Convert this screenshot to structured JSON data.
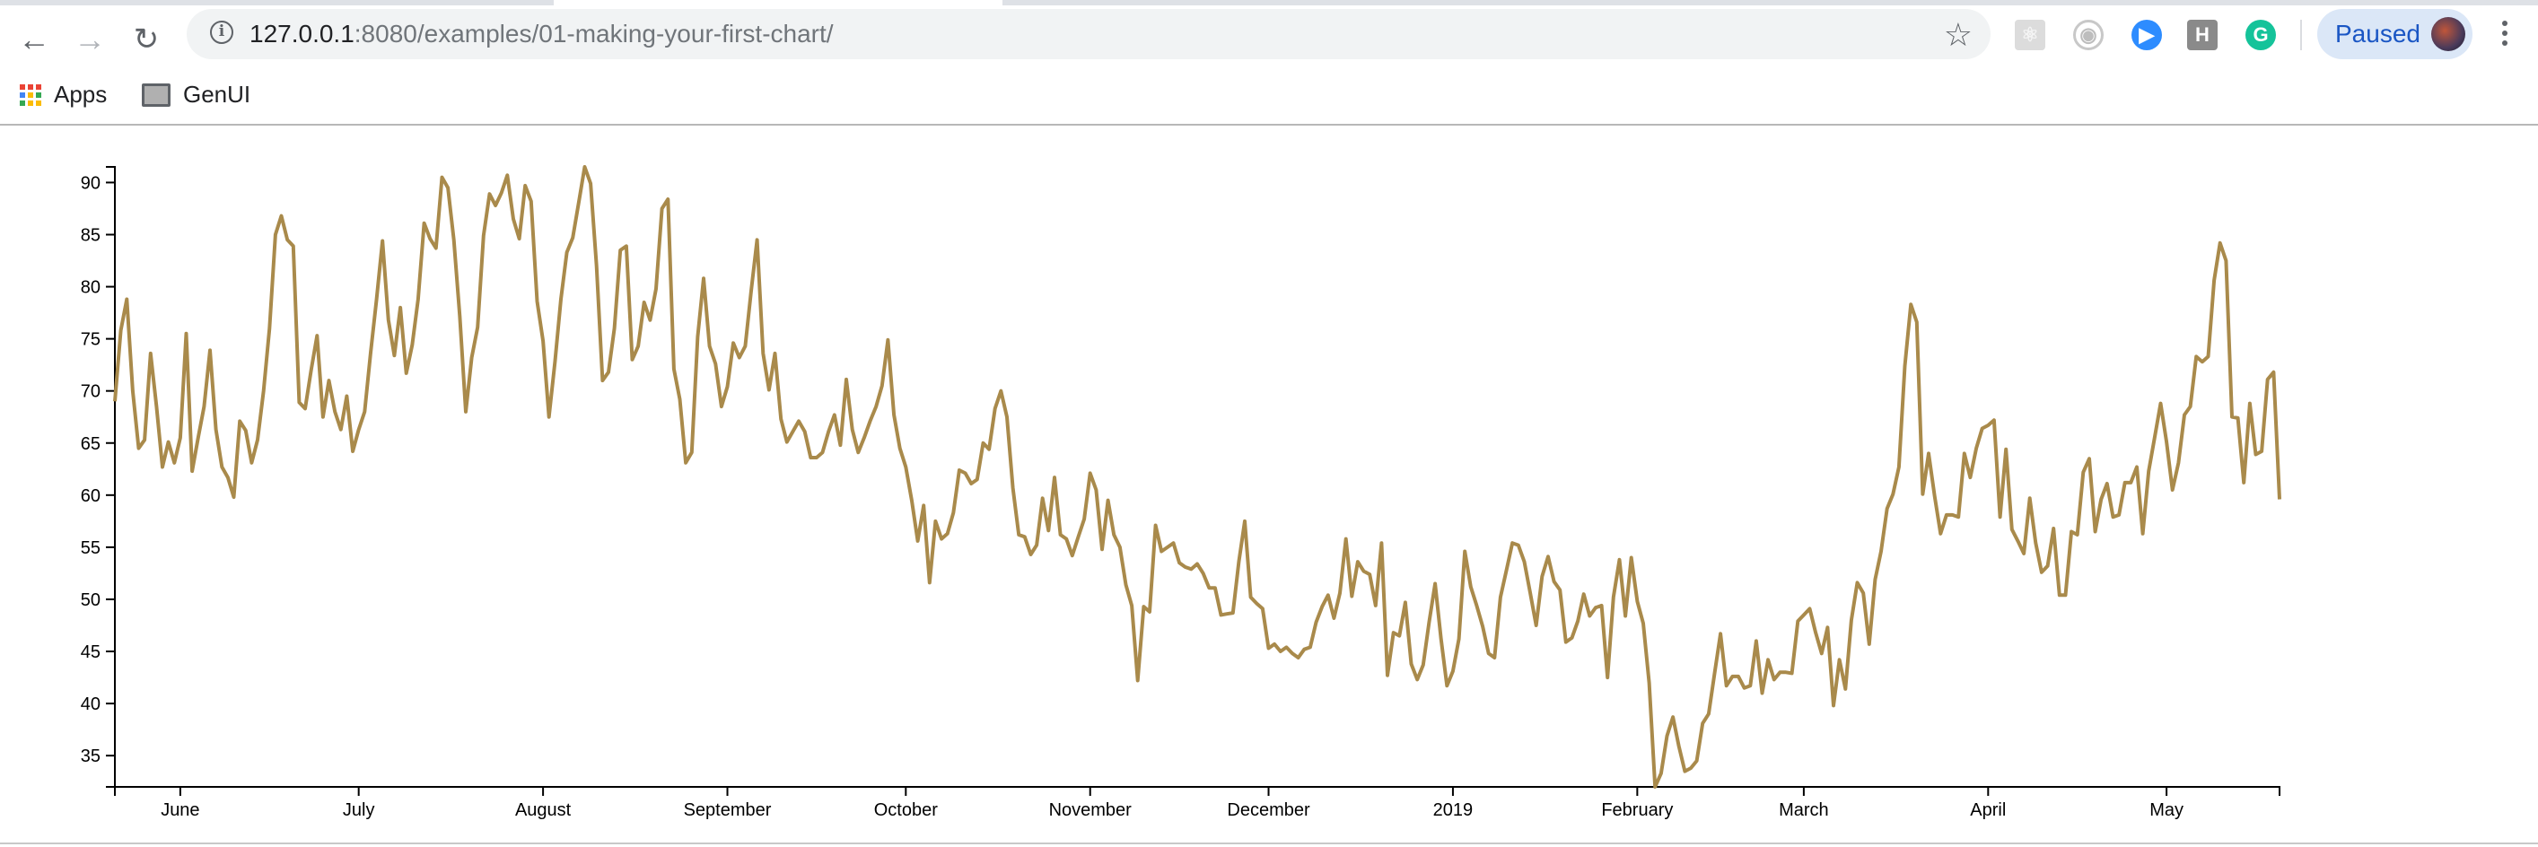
{
  "browser": {
    "url_host": "127.0.0.1",
    "url_rest": ":8080/examples/01-making-your-first-chart/",
    "profile_label": "Paused",
    "extensions": [
      {
        "icon": "react-devtools-icon",
        "glyph": "⚛",
        "color": "#dcdcdc"
      },
      {
        "icon": "record-icon",
        "glyph": "◉",
        "color": "#ffffff"
      },
      {
        "icon": "zoom-icon",
        "glyph": "▶",
        "color": "#2d8cff"
      },
      {
        "icon": "h-extension-icon",
        "glyph": "H",
        "color": "#8a8a8a"
      },
      {
        "icon": "grammarly-icon",
        "glyph": "G",
        "color": "#15c39a"
      }
    ],
    "bookmarks": [
      {
        "label": "Apps",
        "icon": "apps-grid-icon"
      },
      {
        "label": "GenUI",
        "icon": "folder-icon"
      }
    ]
  },
  "chart_data": {
    "type": "line",
    "title": "",
    "xlabel": "",
    "ylabel": "",
    "line_color": "#a98a4b",
    "grid": false,
    "ylim": [
      32.0,
      91.5
    ],
    "xlim": [
      "2018-05-21",
      "2019-05-20"
    ],
    "y_ticks": [
      "35",
      "40",
      "45",
      "50",
      "55",
      "60",
      "65",
      "70",
      "75",
      "80",
      "85",
      "90"
    ],
    "x_ticks": [
      {
        "date": "2018-06-01",
        "label": "June"
      },
      {
        "date": "2018-07-01",
        "label": "July"
      },
      {
        "date": "2018-08-01",
        "label": "August"
      },
      {
        "date": "2018-09-01",
        "label": "September"
      },
      {
        "date": "2018-10-01",
        "label": "October"
      },
      {
        "date": "2018-11-01",
        "label": "November"
      },
      {
        "date": "2018-12-01",
        "label": "December"
      },
      {
        "date": "2019-01-01",
        "label": "2019"
      },
      {
        "date": "2019-02-01",
        "label": "February"
      },
      {
        "date": "2019-03-01",
        "label": "March"
      },
      {
        "date": "2019-04-01",
        "label": "April"
      },
      {
        "date": "2019-05-01",
        "label": "May"
      }
    ],
    "series_by_month": [
      {
        "month": "2018-05",
        "first_day": 21,
        "values": [
          69.0,
          75.8,
          78.8,
          70.0,
          64.5,
          65.3,
          73.6,
          68.5,
          62.7,
          65.1,
          63.1
        ]
      },
      {
        "month": "2018-06",
        "first_day": 1,
        "values": [
          65.5,
          75.5,
          62.3,
          65.5,
          68.5,
          73.9,
          66.3,
          62.7,
          61.7,
          59.8,
          67.1,
          66.2,
          63.1,
          65.3,
          70.0,
          76.0,
          85.0,
          86.8,
          84.5,
          83.9,
          68.9,
          68.3,
          72.0,
          75.3,
          67.5,
          71.0,
          68.0,
          66.3,
          69.5,
          64.2
        ]
      },
      {
        "month": "2018-07",
        "first_day": 1,
        "values": [
          66.3,
          68.0,
          73.6,
          78.8,
          84.4,
          76.8,
          73.4,
          78.0,
          71.7,
          74.4,
          78.8,
          86.1,
          84.6,
          83.7,
          90.5,
          89.5,
          84.5,
          77.2,
          68.0,
          73.2,
          76.1,
          84.9,
          88.9,
          87.8,
          89.0,
          90.7,
          86.5,
          84.6,
          89.7,
          88.2,
          78.6
        ]
      },
      {
        "month": "2018-08",
        "first_day": 1,
        "values": [
          74.8,
          67.5,
          72.8,
          78.8,
          83.3,
          84.7,
          88.1,
          91.5,
          89.9,
          82.0,
          71.0,
          71.8,
          76.0,
          83.5,
          83.9,
          73.0,
          74.3,
          78.5,
          76.8,
          79.8,
          87.5,
          88.4,
          72.1,
          69.2,
          63.1,
          64.1,
          75.2,
          80.8,
          74.3,
          72.6,
          68.5
        ]
      },
      {
        "month": "2018-09",
        "first_day": 1,
        "values": [
          70.4,
          74.6,
          73.2,
          74.3,
          79.6,
          84.5,
          73.6,
          70.1,
          73.6,
          67.3,
          65.1,
          66.1,
          67.1,
          66.1,
          63.6,
          63.6,
          64.1,
          66.1,
          67.7,
          64.8,
          71.1,
          66.3,
          64.1,
          65.5,
          67.1,
          68.5,
          70.5,
          74.9,
          67.7,
          64.5
        ]
      },
      {
        "month": "2018-10",
        "first_day": 1,
        "values": [
          62.7,
          59.5,
          55.6,
          59.0,
          51.6,
          57.5,
          55.8,
          56.3,
          58.3,
          62.4,
          62.1,
          61.1,
          61.5,
          65.0,
          64.4,
          68.3,
          70.0,
          67.5,
          60.7,
          56.2,
          56.0,
          54.3,
          55.2,
          59.7,
          56.6,
          61.7,
          56.2,
          55.8,
          54.2,
          56.0,
          57.7
        ]
      },
      {
        "month": "2018-11",
        "first_day": 1,
        "values": [
          62.1,
          60.5,
          54.8,
          59.5,
          56.2,
          55.0,
          51.4,
          49.4,
          42.2,
          49.3,
          48.8,
          57.1,
          54.6,
          55.0,
          55.4,
          53.5,
          53.1,
          52.9,
          53.4,
          52.5,
          51.1,
          51.1,
          48.5,
          48.6,
          48.7,
          53.6,
          57.5,
          50.2,
          49.6,
          49.1
        ]
      },
      {
        "month": "2018-12",
        "first_day": 1,
        "values": [
          45.3,
          45.7,
          45.0,
          45.4,
          44.8,
          44.4,
          45.2,
          45.4,
          47.8,
          49.3,
          50.4,
          48.2,
          50.6,
          55.8,
          50.3,
          53.6,
          52.7,
          52.4,
          49.4,
          55.4,
          42.7,
          46.8,
          46.5,
          49.7,
          43.8,
          42.3,
          43.7,
          47.8,
          51.5,
          46.2,
          41.7
        ]
      },
      {
        "month": "2019-01",
        "first_day": 1,
        "values": [
          43.1,
          46.2,
          54.6,
          51.2,
          49.4,
          47.4,
          44.8,
          44.4,
          50.2,
          52.8,
          55.4,
          55.2,
          53.6,
          50.6,
          47.5,
          52.2,
          54.1,
          51.7,
          50.9,
          45.9,
          46.3,
          47.9,
          50.5,
          48.4,
          49.2,
          49.4,
          42.5,
          50.2,
          53.8,
          48.4,
          54.0
        ]
      },
      {
        "month": "2019-02",
        "first_day": 1,
        "values": [
          49.8,
          47.7,
          42.0,
          32.0,
          33.3,
          36.9,
          38.7,
          35.9,
          33.5,
          33.8,
          34.5,
          38.1,
          39.0,
          42.9,
          46.7,
          41.7,
          42.6,
          42.6,
          41.5,
          41.7,
          46.0,
          41.0,
          44.2,
          42.3,
          43.0,
          43.0,
          42.9,
          47.9
        ]
      },
      {
        "month": "2019-03",
        "first_day": 1,
        "values": [
          48.5,
          49.1,
          46.8,
          44.8,
          47.3,
          39.8,
          44.2,
          41.4,
          48.0,
          51.6,
          50.6,
          45.7,
          51.9,
          54.6,
          58.7,
          60.1,
          62.7,
          72.4,
          78.3,
          76.6,
          60.1,
          64.0,
          59.9,
          56.3,
          58.1,
          58.1,
          57.9,
          64.0,
          61.7,
          64.5,
          66.4
        ]
      },
      {
        "month": "2019-04",
        "first_day": 1,
        "values": [
          66.7,
          67.2,
          57.9,
          64.4,
          56.7,
          55.6,
          54.4,
          59.7,
          55.4,
          52.6,
          53.2,
          56.8,
          50.4,
          50.4,
          56.5,
          56.2,
          62.2,
          63.5,
          56.5,
          59.6,
          61.1,
          57.9,
          58.1,
          61.2,
          61.2,
          62.7,
          56.3,
          62.3,
          65.5,
          68.8
        ]
      },
      {
        "month": "2019-05",
        "first_day": 1,
        "values": [
          65.1,
          60.5,
          63.1,
          67.7,
          68.5,
          73.3,
          72.8,
          73.3,
          80.6,
          84.2,
          82.5,
          67.5,
          67.4,
          61.2,
          68.8,
          63.9,
          64.2,
          71.1,
          71.8,
          59.6
        ]
      }
    ]
  }
}
